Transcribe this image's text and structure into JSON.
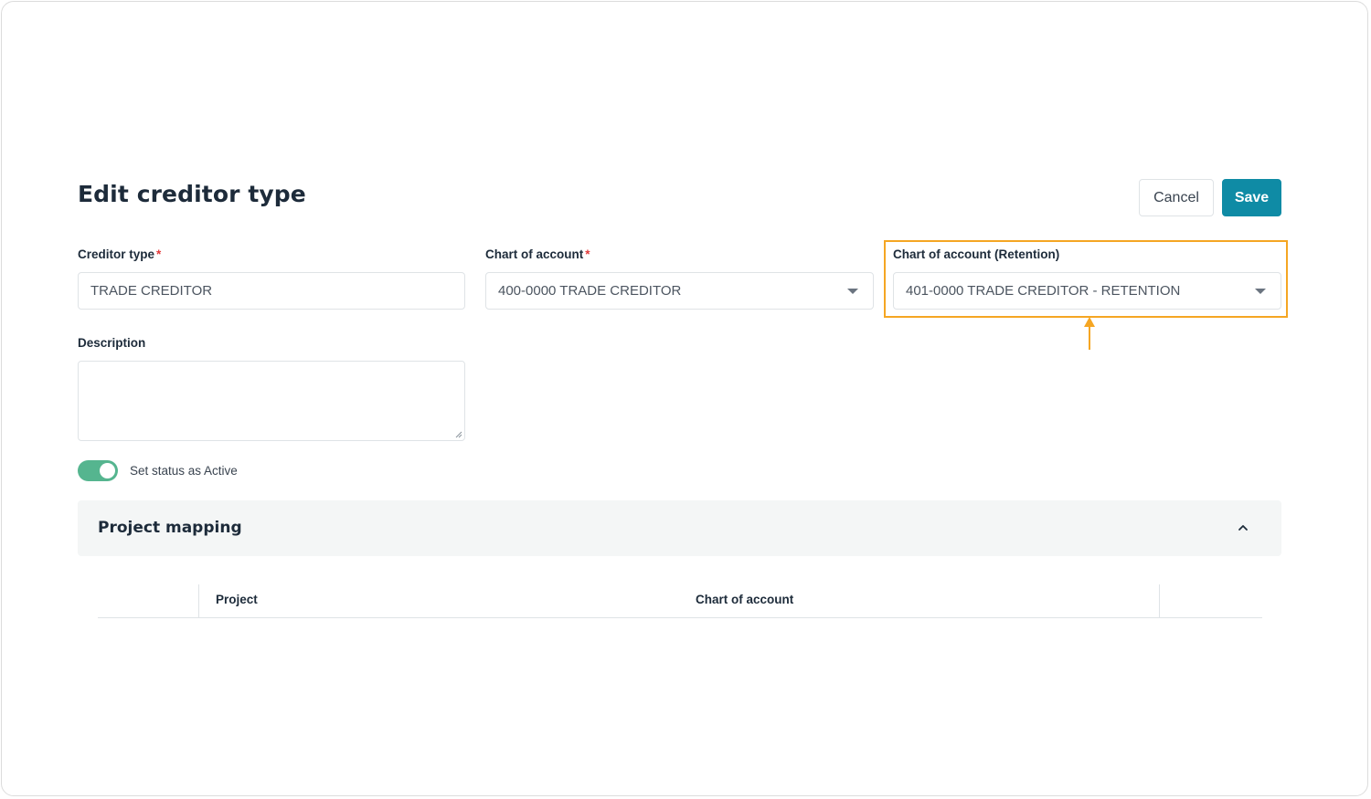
{
  "page": {
    "title": "Edit creditor type"
  },
  "actions": {
    "cancel_label": "Cancel",
    "save_label": "Save"
  },
  "form": {
    "creditor_type": {
      "label": "Creditor type",
      "required_mark": "*",
      "value": "TRADE CREDITOR"
    },
    "chart_of_account": {
      "label": "Chart of account",
      "required_mark": "*",
      "value": "400-0000 TRADE CREDITOR"
    },
    "chart_of_account_retention": {
      "label": "Chart of account (Retention)",
      "value": "401-0000 TRADE CREDITOR - RETENTION"
    },
    "description": {
      "label": "Description",
      "value": ""
    },
    "status": {
      "label": "Set status as Active",
      "active": true
    }
  },
  "project_mapping": {
    "title": "Project mapping",
    "expanded": true,
    "columns": [
      "Project",
      "Chart of account"
    ]
  },
  "colors": {
    "accent": "#0f8ba5",
    "highlight": "#f5a623",
    "toggle_on": "#55b58f",
    "required": "#e23b3b"
  }
}
